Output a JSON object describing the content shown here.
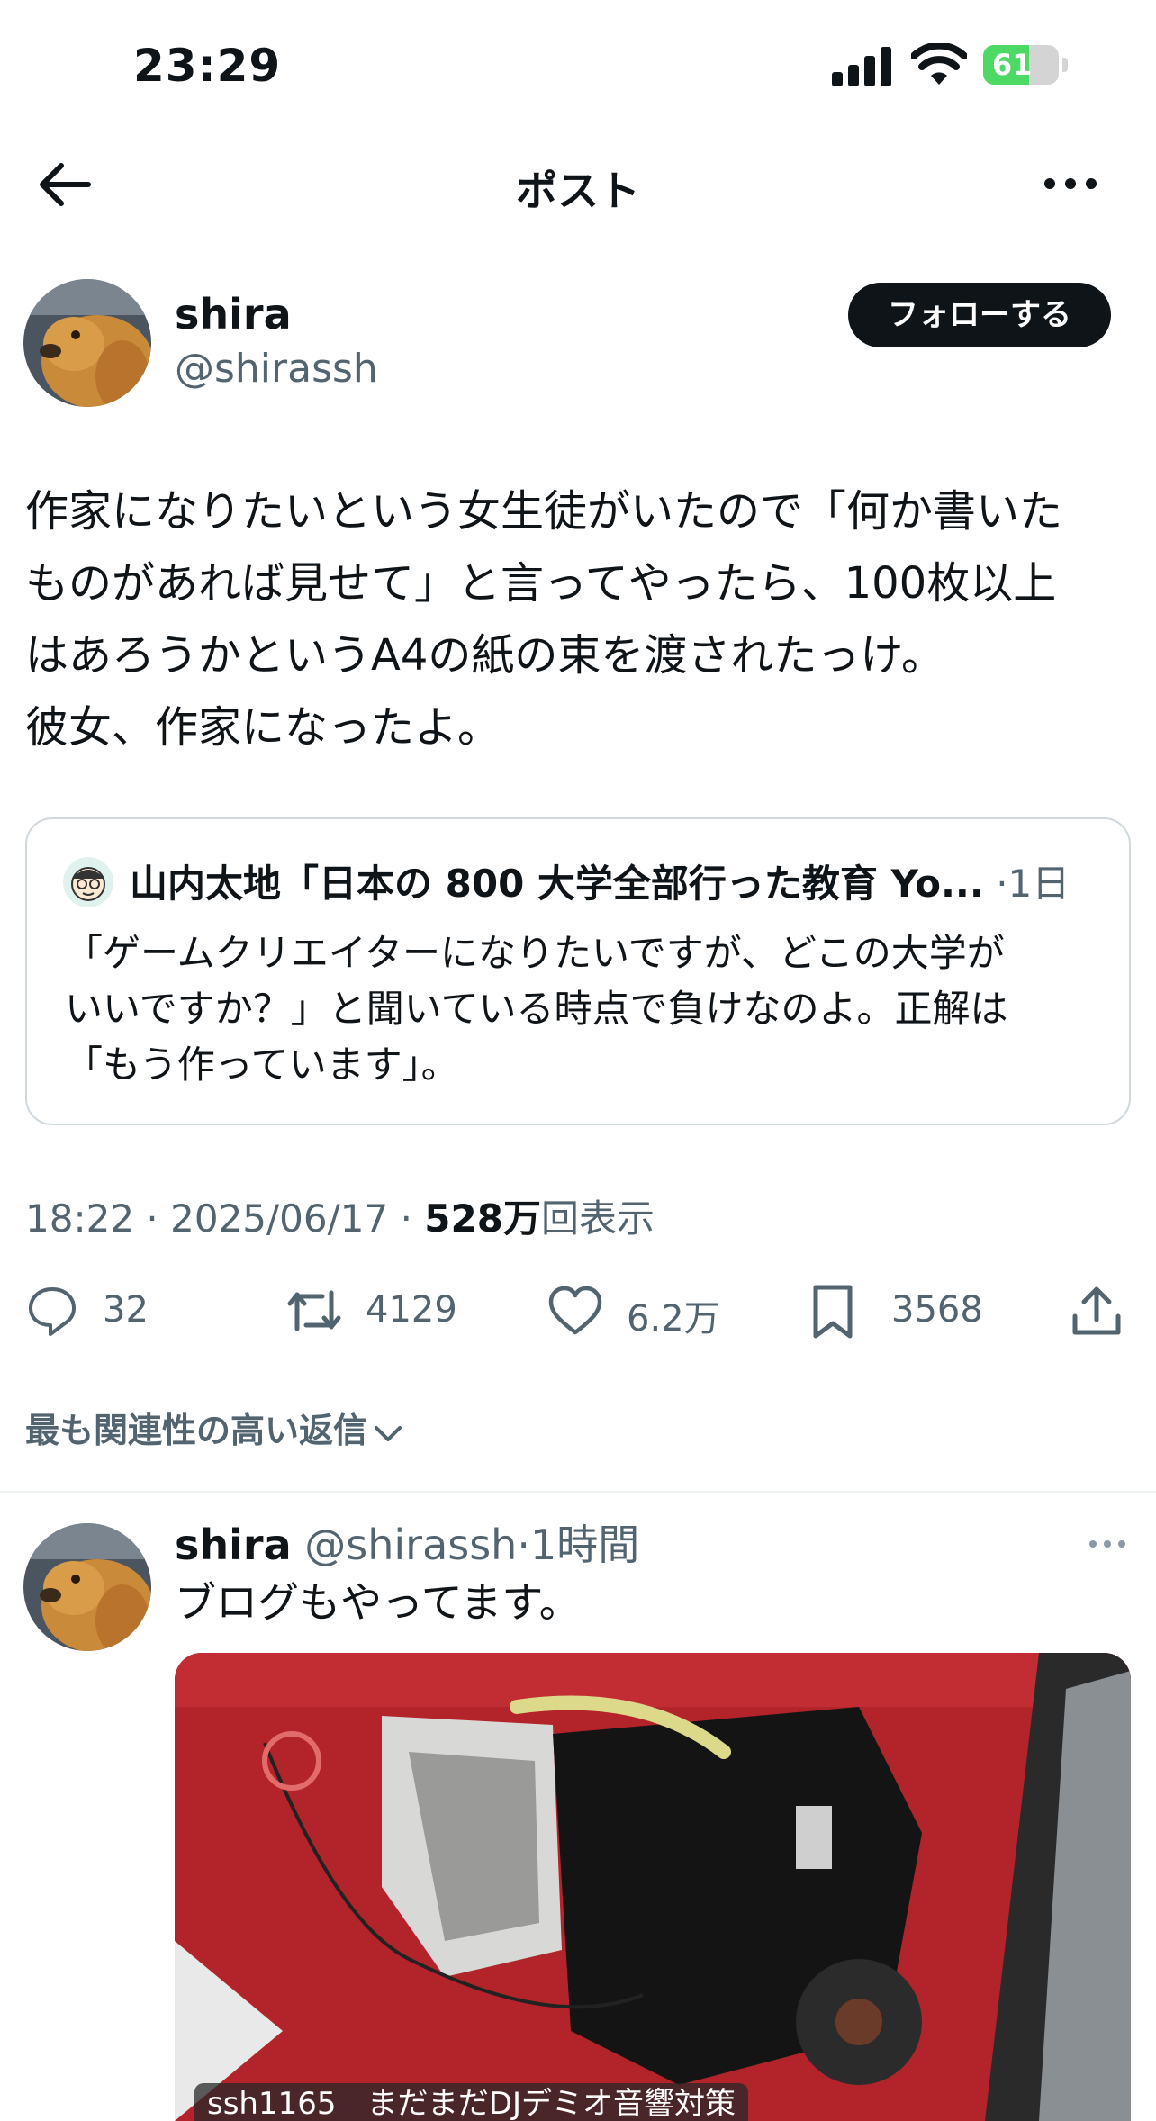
{
  "status_bar": {
    "time": "23:29",
    "battery_percent": "61",
    "battery_level": 0.61,
    "colors": {
      "battery_fill": "#4cd964"
    }
  },
  "nav": {
    "title": "ポスト",
    "back_icon": "arrow-left-icon",
    "more_icon": "more-horizontal-icon"
  },
  "post": {
    "author": {
      "name": "shira",
      "handle": "@shirassh",
      "follow_label": "フォローする",
      "avatar_icon": "dog-photo-avatar"
    },
    "text_lines": [
      "作家になりたいという女生徒がいたので「何か書いた",
      "ものがあれば見せて」と言ってやったら、100枚以上",
      "はあろうかというA4の紙の束を渡されたっけ。",
      "彼女、作家になったよ。"
    ],
    "quote": {
      "author": "山内太地「日本の 800 大学全部行った教育 Yo...",
      "separator": "·",
      "time": "1日",
      "avatar_icon": "cartoon-face-avatar",
      "text_lines": [
        "「ゲームクリエイターになりたいですが、どこの大学が",
        "いいですか？」と聞いている時点で負けなのよ。正解は",
        "「もう作っています」。"
      ]
    },
    "meta": {
      "time": "18:22",
      "date": "2025/06/17",
      "separator": "·",
      "views_count": "528万",
      "views_label": "回表示"
    },
    "actions": {
      "replies": "32",
      "reposts": "4129",
      "likes": "6.2万",
      "bookmarks": "3568",
      "icons": [
        "reply-icon",
        "repost-icon",
        "like-icon",
        "bookmark-icon",
        "share-icon"
      ]
    }
  },
  "replies_section": {
    "sort_label": "最も関連性の高い返信",
    "replies": [
      {
        "name": "shira",
        "handle": "@shirassh",
        "separator": "·",
        "time": "1時間",
        "text": "ブログもやってます。",
        "image_caption": "ssh1165　まだまだDJデミオ音響対策"
      }
    ]
  },
  "colors": {
    "text_primary": "#0f1419",
    "text_secondary": "#536471",
    "border": "#cfd9de",
    "follow_button_bg": "#0f1419"
  }
}
